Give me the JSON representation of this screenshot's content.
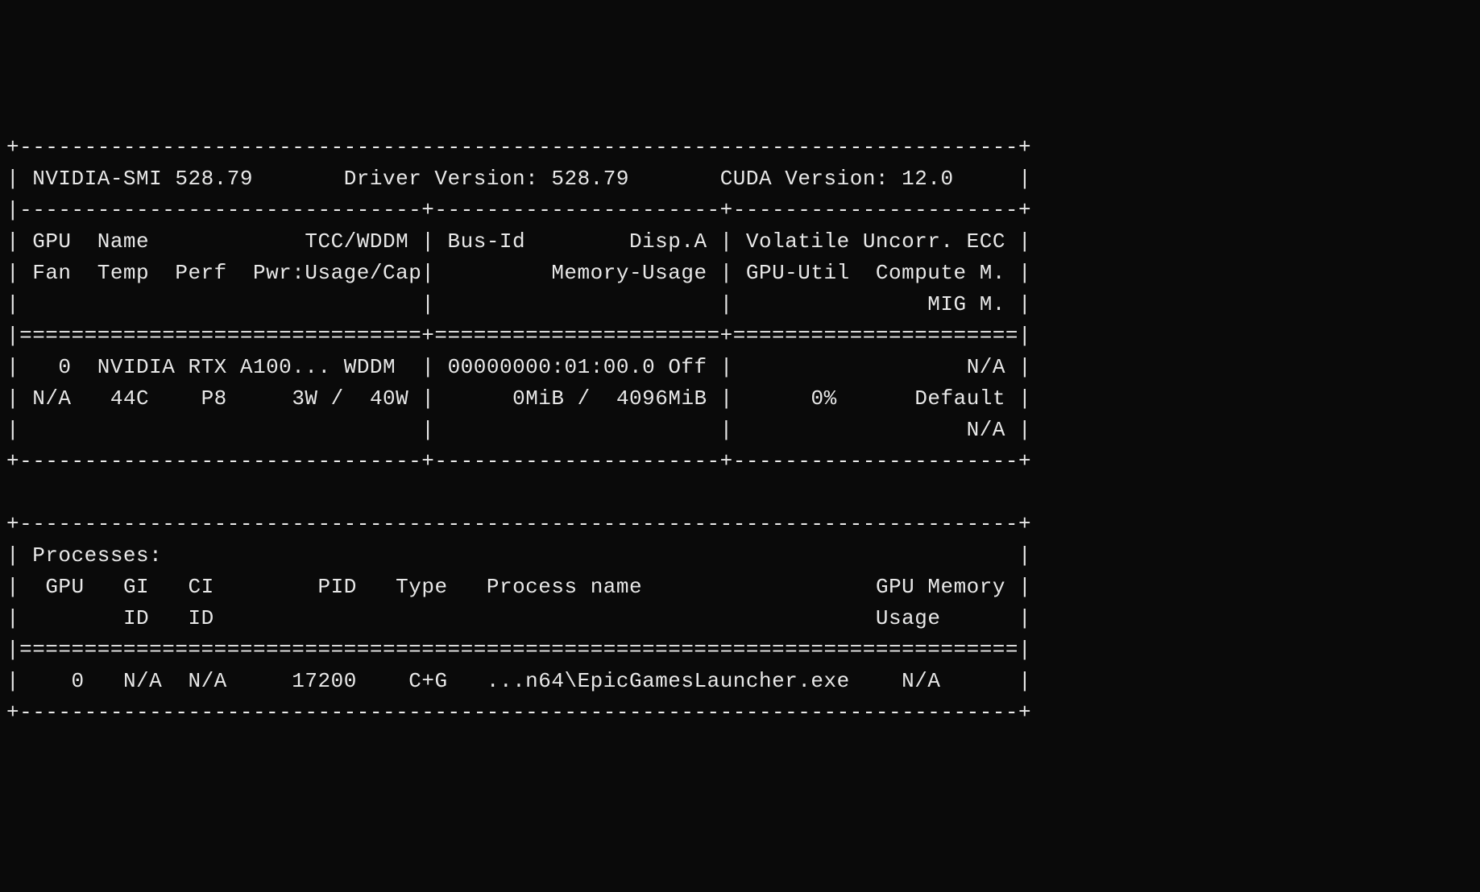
{
  "header": {
    "smi_label": "NVIDIA-SMI",
    "smi_version": "528.79",
    "driver_label": "Driver Version:",
    "driver_version": "528.79",
    "cuda_label": "CUDA Version:",
    "cuda_version": "12.0"
  },
  "column_headers": {
    "line1_col1": "GPU  Name            TCC/WDDM",
    "line1_col2": "Bus-Id        Disp.A",
    "line1_col3": "Volatile Uncorr. ECC",
    "line2_col1": "Fan  Temp  Perf  Pwr:Usage/Cap",
    "line2_col2": "Memory-Usage",
    "line2_col3": "GPU-Util  Compute M.",
    "line3_col3": "MIG M."
  },
  "gpu": {
    "index": "0",
    "name": "NVIDIA RTX A100...",
    "mode": "WDDM",
    "bus_id": "00000000:01:00.0",
    "disp_a": "Off",
    "ecc": "N/A",
    "fan": "N/A",
    "temp": "44C",
    "perf": "P8",
    "pwr_usage": "3W",
    "pwr_cap": "40W",
    "mem_used": "0MiB",
    "mem_total": "4096MiB",
    "gpu_util": "0%",
    "compute_m": "Default",
    "mig_m": "N/A"
  },
  "processes": {
    "title": "Processes:",
    "headers": {
      "gpu": "GPU",
      "gi": "GI",
      "ci": "CI",
      "pid": "PID",
      "type": "Type",
      "name": "Process name",
      "mem": "GPU Memory",
      "gi_id": "ID",
      "ci_id": "ID",
      "usage": "Usage"
    },
    "rows": [
      {
        "gpu": "0",
        "gi": "N/A",
        "ci": "N/A",
        "pid": "17200",
        "type": "C+G",
        "name": "...n64\\EpicGamesLauncher.exe",
        "mem": "N/A"
      }
    ]
  },
  "lines": {
    "top_border": "+-----------------------------------------------------------------------------+",
    "header_sep": "|-------------------------------+----------------------+----------------------+",
    "double_sep": "|===============================+======================+======================|",
    "bottom_sep": "+-------------------------------+----------------------+----------------------+",
    "proc_top": "+-----------------------------------------------------------------------------+",
    "proc_double": "|=============================================================================|",
    "proc_bottom": "+-----------------------------------------------------------------------------+"
  }
}
